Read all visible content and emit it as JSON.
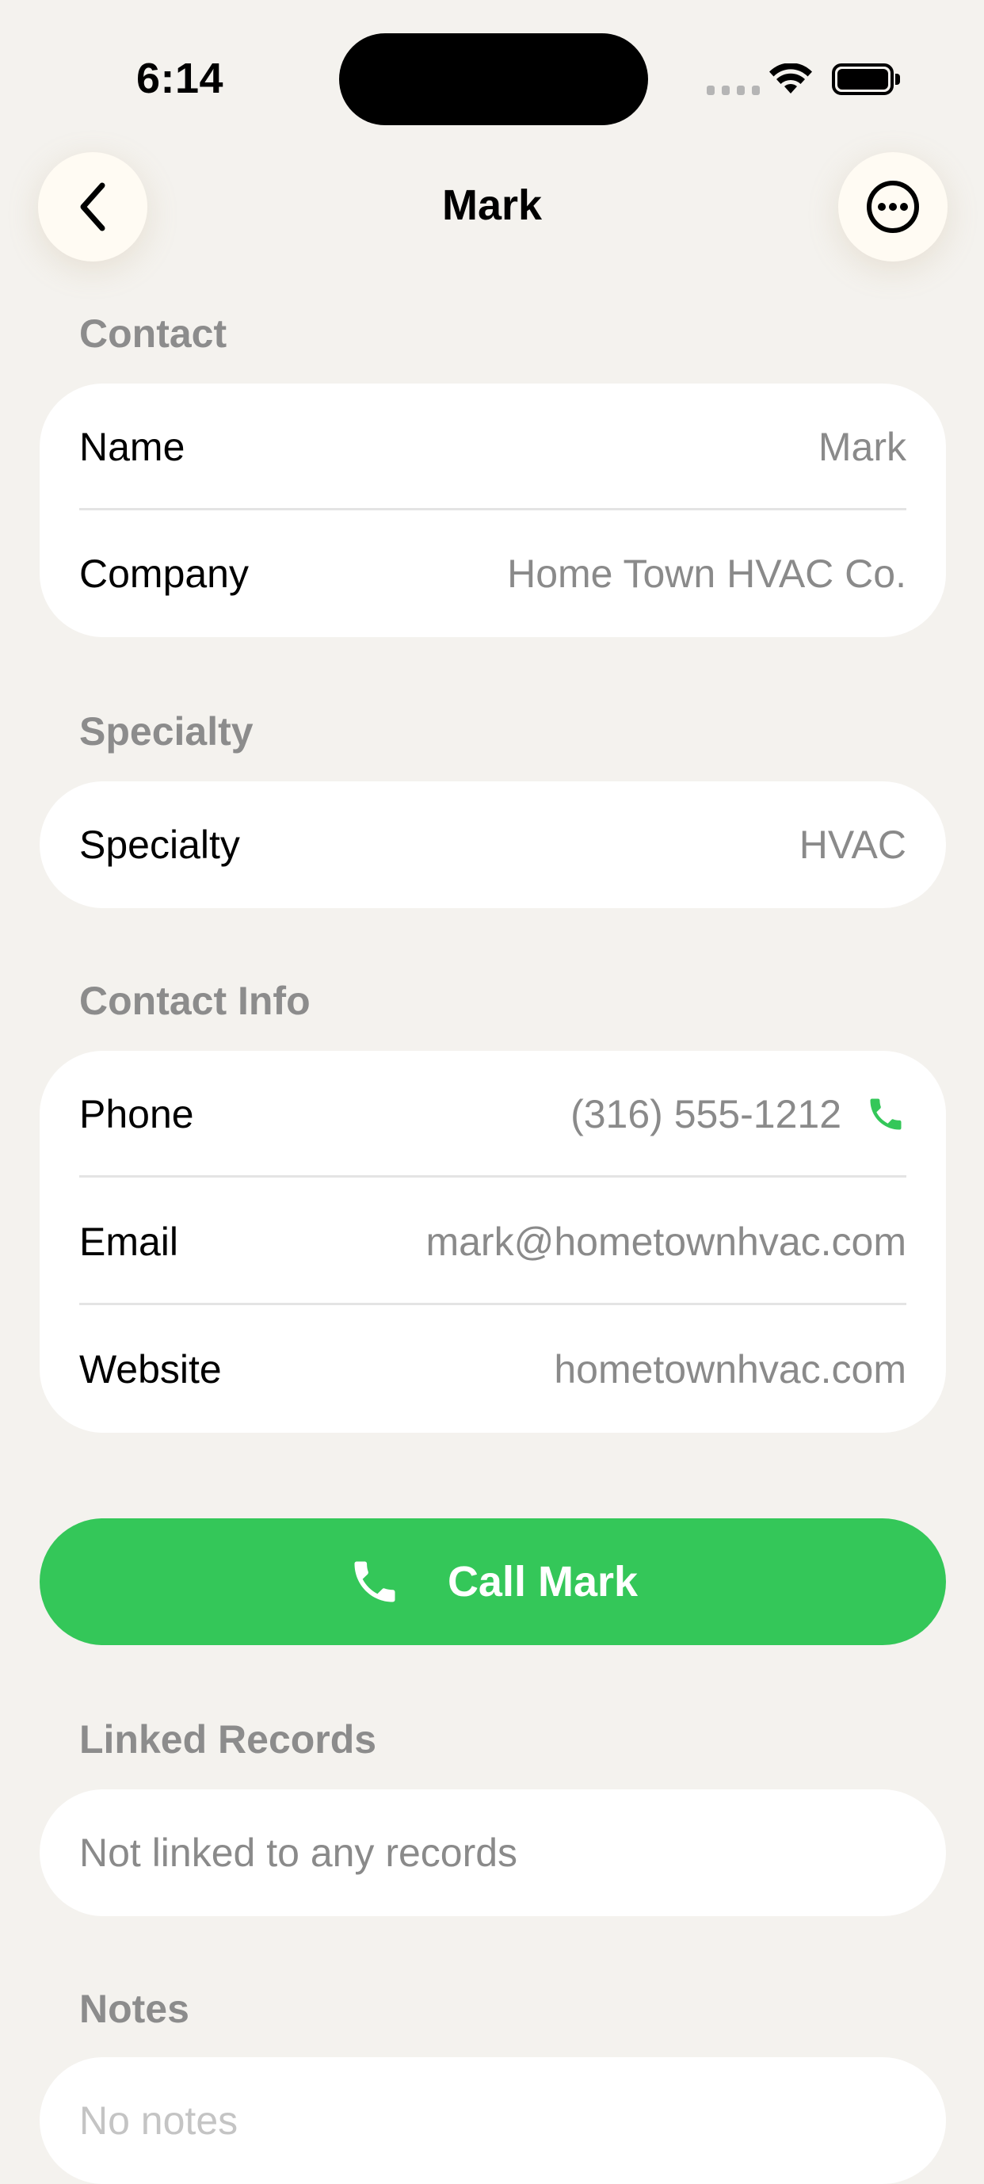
{
  "status_bar": {
    "time": "6:14"
  },
  "nav": {
    "title": "Mark",
    "back_icon": "chevron-left-icon",
    "more_icon": "ellipsis-circle-icon"
  },
  "sections": {
    "contact": {
      "header": "Contact",
      "name_label": "Name",
      "name_value": "Mark",
      "company_label": "Company",
      "company_value": "Home Town HVAC Co."
    },
    "specialty": {
      "header": "Specialty",
      "specialty_label": "Specialty",
      "specialty_value": "HVAC"
    },
    "contact_info": {
      "header": "Contact Info",
      "phone_label": "Phone",
      "phone_value": "(316) 555-1212",
      "email_label": "Email",
      "email_value": "mark@hometownhvac.com",
      "website_label": "Website",
      "website_value": "hometownhvac.com"
    },
    "call_button": {
      "label": "Call Mark",
      "icon": "phone-icon"
    },
    "linked_records": {
      "header": "Linked Records",
      "empty_text": "Not linked to any records"
    },
    "notes": {
      "header": "Notes",
      "placeholder": "No notes"
    }
  },
  "colors": {
    "background": "#f4f2ee",
    "accent_green": "#34c759",
    "section_header": "#8c8c8c",
    "secondary_text": "#8a8a8a"
  }
}
